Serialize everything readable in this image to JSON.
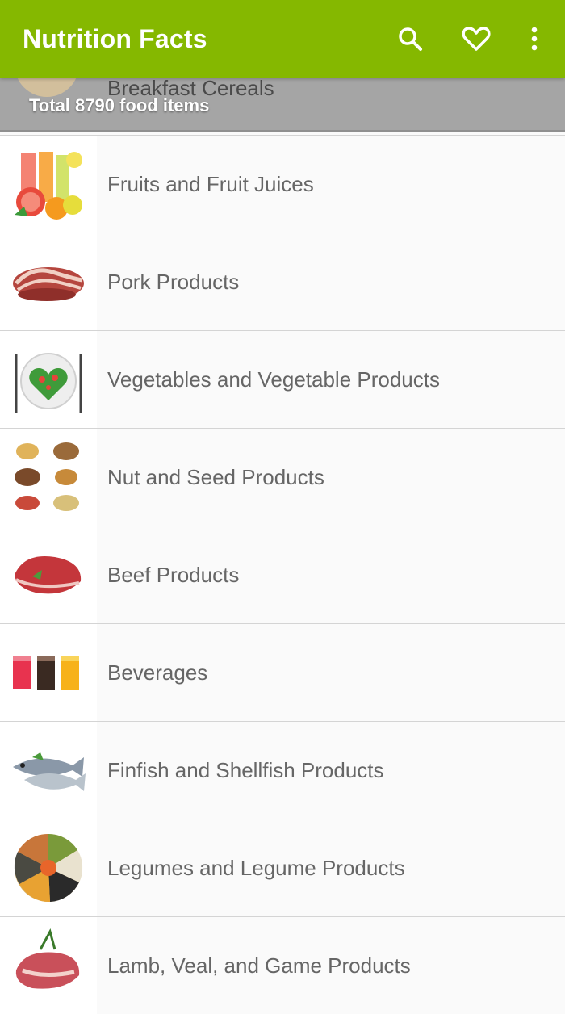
{
  "app": {
    "title": "Nutrition Facts"
  },
  "actions": {
    "search": "search-icon",
    "favorite": "heart-icon",
    "more": "more-vert-icon"
  },
  "header": {
    "category": "Breakfast Cereals",
    "total": "Total 8790 food items"
  },
  "categories": [
    {
      "label": "Fruits and Fruit Juices",
      "icon": "fruit-juice-icon"
    },
    {
      "label": "Pork Products",
      "icon": "pork-icon"
    },
    {
      "label": "Vegetables and Vegetable Products",
      "icon": "vegetable-plate-icon"
    },
    {
      "label": "Nut and Seed Products",
      "icon": "nuts-icon"
    },
    {
      "label": "Beef Products",
      "icon": "beef-icon"
    },
    {
      "label": "Beverages",
      "icon": "beverages-icon"
    },
    {
      "label": "Finfish and Shellfish Products",
      "icon": "fish-icon"
    },
    {
      "label": "Legumes and Legume Products",
      "icon": "legumes-icon"
    },
    {
      "label": "Lamb, Veal, and Game Products",
      "icon": "lamb-icon"
    }
  ],
  "colors": {
    "accent": "#85b800",
    "text": "#666666"
  }
}
